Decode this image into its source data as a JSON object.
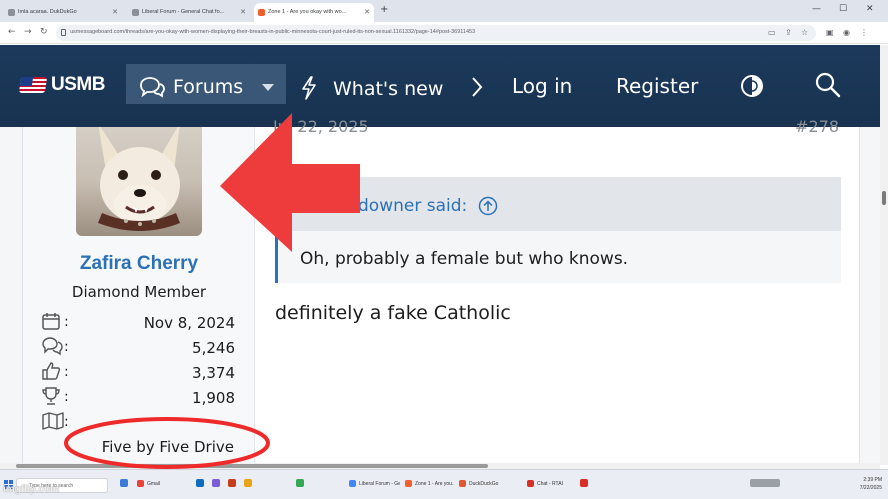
{
  "browser": {
    "tabs": [
      {
        "label": "Imla acaraa. DukDukGo"
      },
      {
        "label": "Liberal Forum - General Chat fo..."
      },
      {
        "label": "Zone 1 - Are you okay with wo..."
      }
    ],
    "new_tab": "+",
    "minimize": "—",
    "maximize": "☐",
    "close": "✕",
    "url": "usmessageboard.com/threads/are-you-okay-with-women-displaying-their-breasts-in-public-minnesota-court-just-ruled-its-non-sexual.1161332/page-14#post-36911453"
  },
  "site": {
    "logo": "USMB",
    "nav": {
      "forums": "Forums",
      "whats_new": "What's new",
      "login": "Log in",
      "register": "Register"
    }
  },
  "post": {
    "date": "Jul 22, 2025",
    "number": "#278",
    "user": {
      "name": "Zafira Cherry",
      "title": "Diamond Member",
      "stats": [
        {
          "icon": "calendar-icon",
          "value": "Nov 8, 2024"
        },
        {
          "icon": "messages-icon",
          "value": "5,246"
        },
        {
          "icon": "thumbs-up-icon",
          "value": "3,374"
        },
        {
          "icon": "trophy-icon",
          "value": "1,908"
        }
      ],
      "location": "Five by Five Drive"
    },
    "quote": {
      "author": "debbiedowner said:",
      "body": "Oh, probably a female but who knows."
    },
    "message": "definitely a fake Catholic"
  },
  "taskbar": {
    "search_placeholder": "Type here to search",
    "apps": [
      "Gmail",
      "Liberal Forum - Ge...",
      "Zone 1 - Are you...",
      "DuckDuckGo",
      "Chat - RTAI"
    ],
    "time": "2:39 PM",
    "date": "7/22/2025"
  },
  "watermark": "imgflip.com",
  "colors": {
    "header_bg": "#1d3a5c",
    "nav_active": "#3b5778",
    "link_blue": "#2a71b8",
    "annotation_red": "#ee3b3b"
  }
}
